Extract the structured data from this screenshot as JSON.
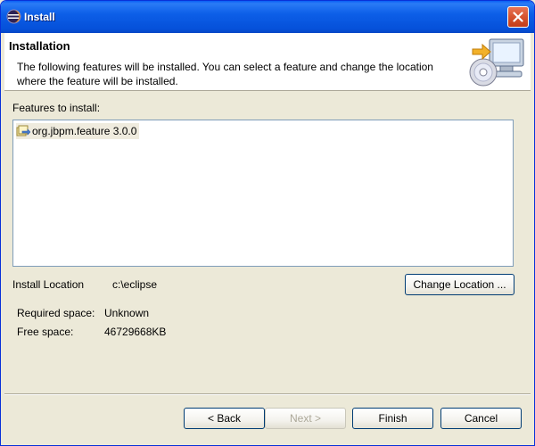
{
  "window": {
    "title": "Install",
    "close_icon": "close-icon",
    "app_icon": "eclipse-icon"
  },
  "banner": {
    "title": "Installation",
    "description": "The following features will be installed. You can select a feature and change the location where the feature will be installed.",
    "icon": "install-monitor-cd-icon"
  },
  "features": {
    "label": "Features to install:",
    "items": [
      {
        "label": "org.jbpm.feature 3.0.0",
        "icon": "feature-plugin-icon",
        "selected": true
      }
    ]
  },
  "location": {
    "label": "Install Location",
    "value": "c:\\eclipse",
    "change_button": "Change Location ..."
  },
  "space": {
    "required_label": "Required space:",
    "required_value": "Unknown",
    "free_label": "Free space:",
    "free_value": "46729668KB"
  },
  "footer": {
    "back": "< Back",
    "next": "Next >",
    "finish": "Finish",
    "cancel": "Cancel"
  }
}
